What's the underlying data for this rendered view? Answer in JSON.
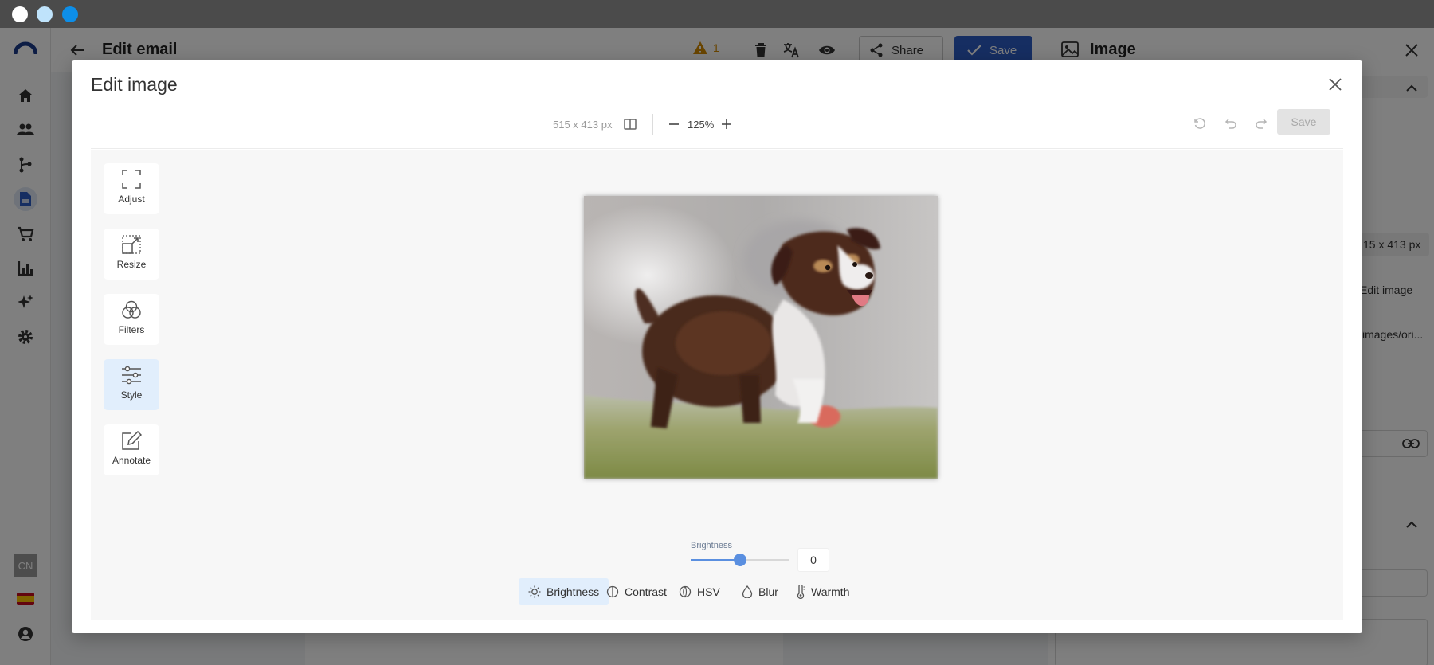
{
  "window": {
    "dots": [
      {
        "name": "window-close-dot",
        "color": "#ffffff"
      },
      {
        "name": "window-minimize-dot",
        "color": "#bfe3fb"
      },
      {
        "name": "window-maximize-dot",
        "color": "#0d8ee8"
      }
    ]
  },
  "background": {
    "header": {
      "title": "Edit email",
      "warning_count": "1",
      "share_label": "Share",
      "save_label": "Save"
    },
    "side_panel": {
      "title": "Image",
      "dimensions_fragment": "15 x 413 px",
      "edit_image_fragment": "Edit image",
      "path_fragment": "images/ori..."
    },
    "rail": {
      "badge": "CN"
    }
  },
  "modal": {
    "title": "Edit image",
    "toolbar": {
      "dimensions": "515 x 413 px",
      "zoom": "125%",
      "save_label": "Save"
    },
    "tools": [
      {
        "id": "adjust",
        "label": "Adjust"
      },
      {
        "id": "resize",
        "label": "Resize"
      },
      {
        "id": "filters",
        "label": "Filters"
      },
      {
        "id": "style",
        "label": "Style"
      },
      {
        "id": "annotate",
        "label": "Annotate"
      }
    ],
    "active_tool": "style",
    "slider": {
      "label": "Brightness",
      "value": "0",
      "fraction": 0.5
    },
    "tabs": [
      {
        "id": "brightness",
        "label": "Brightness"
      },
      {
        "id": "contrast",
        "label": "Contrast"
      },
      {
        "id": "hsv",
        "label": "HSV"
      },
      {
        "id": "blur",
        "label": "Blur"
      },
      {
        "id": "warmth",
        "label": "Warmth"
      }
    ],
    "active_tab": "brightness"
  },
  "colors": {
    "accent": "#5a8fe0",
    "primary_button": "#2c5cc5",
    "active_bg": "#e1eefc"
  }
}
